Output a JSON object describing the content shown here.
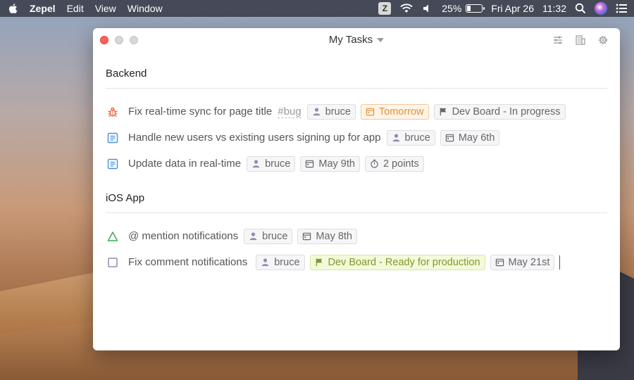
{
  "menubar": {
    "app_name": "Zepel",
    "menus": [
      "Edit",
      "View",
      "Window"
    ],
    "status": {
      "z_label": "Z",
      "battery_percent": "25%",
      "battery_level": 0.25,
      "date": "Fri Apr 26",
      "time": "11:32"
    }
  },
  "window": {
    "title": "My Tasks",
    "sections": [
      {
        "name": "Backend",
        "tasks": [
          {
            "type": "bug",
            "title": "Fix real-time sync for page title",
            "hashtag": "#bug",
            "assignee": "bruce",
            "due": "Tomorrow",
            "board": "Dev Board - In progress"
          },
          {
            "type": "story",
            "title": "Handle new users vs existing users signing up for app",
            "assignee": "bruce",
            "due": "May 6th"
          },
          {
            "type": "story",
            "title": "Update data in real-time",
            "assignee": "bruce",
            "due": "May 9th",
            "points": "2 points"
          }
        ]
      },
      {
        "name": "iOS App",
        "tasks": [
          {
            "type": "feature",
            "title": "@ mention notifications",
            "assignee": "bruce",
            "due": "May 8th"
          },
          {
            "type": "task",
            "title": "Fix comment notifications",
            "assignee": "bruce",
            "board": "Dev Board - Ready for production",
            "due": "May 21st"
          }
        ]
      }
    ]
  },
  "colors": {
    "bug": "#e8653e",
    "story": "#4a90d9",
    "feature": "#3aaa5a",
    "task": "#8a8fb0",
    "due_soon": "#e3913f",
    "ready_board": "#7e9a2f"
  }
}
